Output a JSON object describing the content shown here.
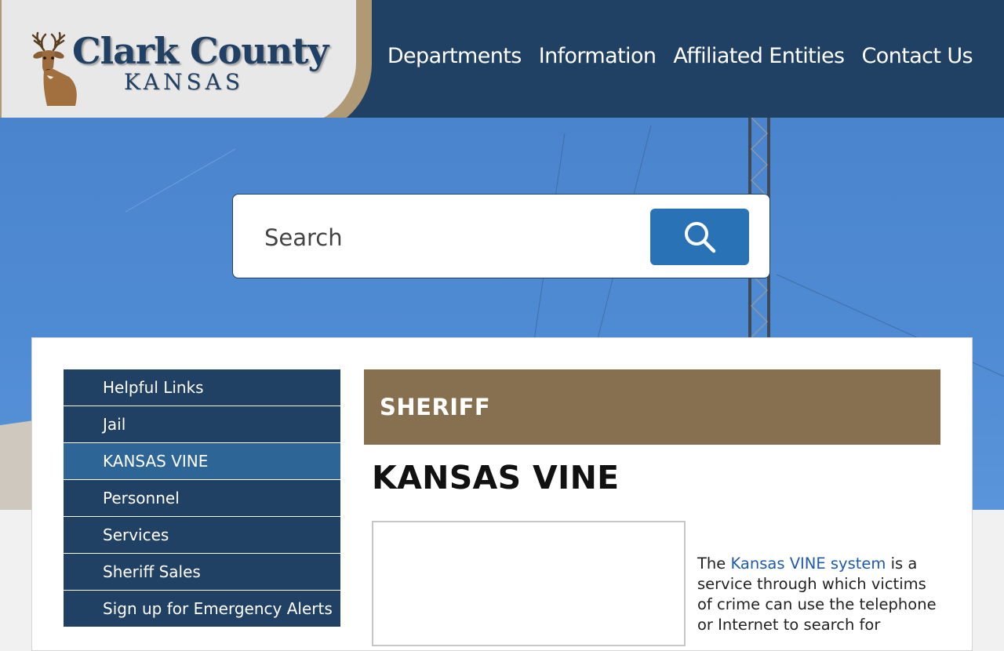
{
  "header": {
    "logo_title": "Clark County",
    "logo_subtitle": "KANSAS",
    "logo_image": "deer-icon",
    "nav": [
      "Departments",
      "Information",
      "Affiliated Entities",
      "Contact Us"
    ]
  },
  "search": {
    "placeholder": "Search",
    "button_icon": "search-icon"
  },
  "sidebar": {
    "items": [
      {
        "label": "Helpful Links"
      },
      {
        "label": "Jail"
      },
      {
        "label": "KANSAS VINE",
        "active": true
      },
      {
        "label": "Personnel"
      },
      {
        "label": "Services"
      },
      {
        "label": "Sheriff Sales"
      },
      {
        "label": "Sign up for Emergency Alerts"
      }
    ]
  },
  "main": {
    "department": "SHERIFF",
    "title": "KANSAS VINE",
    "body_pre": "The ",
    "body_link": "Kansas VINE system",
    "body_post": " is a service through which victims of crime can use the telephone or Internet to search for"
  },
  "colors": {
    "header_bg": "#214164",
    "logo_accent": "#b09a76",
    "search_button": "#2a72b6",
    "sidebar_bg": "#214164",
    "sidebar_active": "#2d6597",
    "department_banner": "#86704f",
    "link": "#1f5aa8"
  }
}
